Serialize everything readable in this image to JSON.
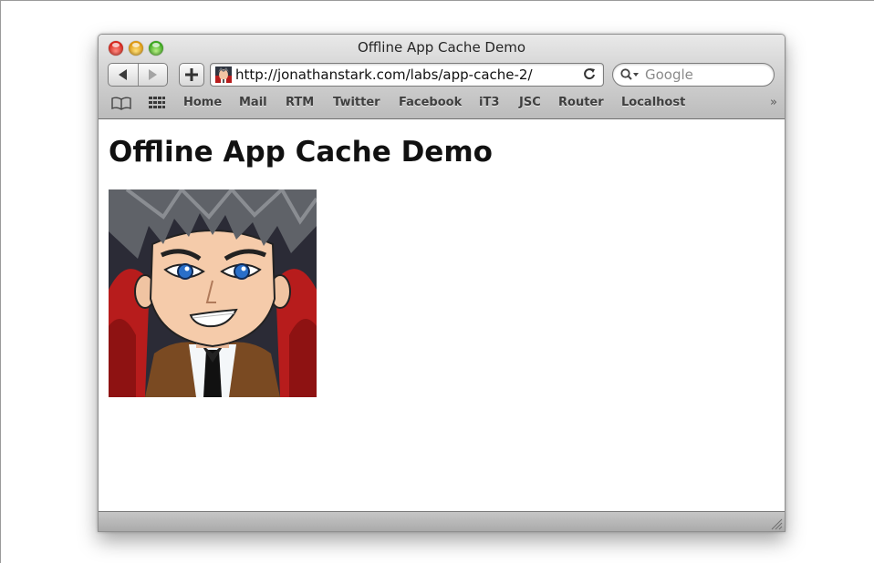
{
  "window": {
    "title": "Offline App Cache Demo"
  },
  "toolbar": {
    "back_icon": "back-arrow-icon",
    "forward_icon": "forward-arrow-icon",
    "add_icon": "plus-icon",
    "url": "http://jonathanstark.com/labs/app-cache-2/",
    "reload_icon": "reload-icon",
    "search_placeholder": "Google"
  },
  "bookmarks": {
    "items": [
      "Home",
      "Mail",
      "RTM",
      "Twitter",
      "Facebook",
      "iT3",
      "JSC",
      "Router",
      "Localhost"
    ],
    "more": "»"
  },
  "page": {
    "heading": "Offline App Cache Demo"
  },
  "colors": {
    "toolbar_top": "#e9e9e9",
    "toolbar_bottom": "#bcbcbc",
    "close": "#d8261c",
    "minimize": "#e09a10",
    "zoom": "#3aa81e",
    "avatar_bg": "#2b2b36",
    "avatar_chair": "#b71c1c"
  }
}
